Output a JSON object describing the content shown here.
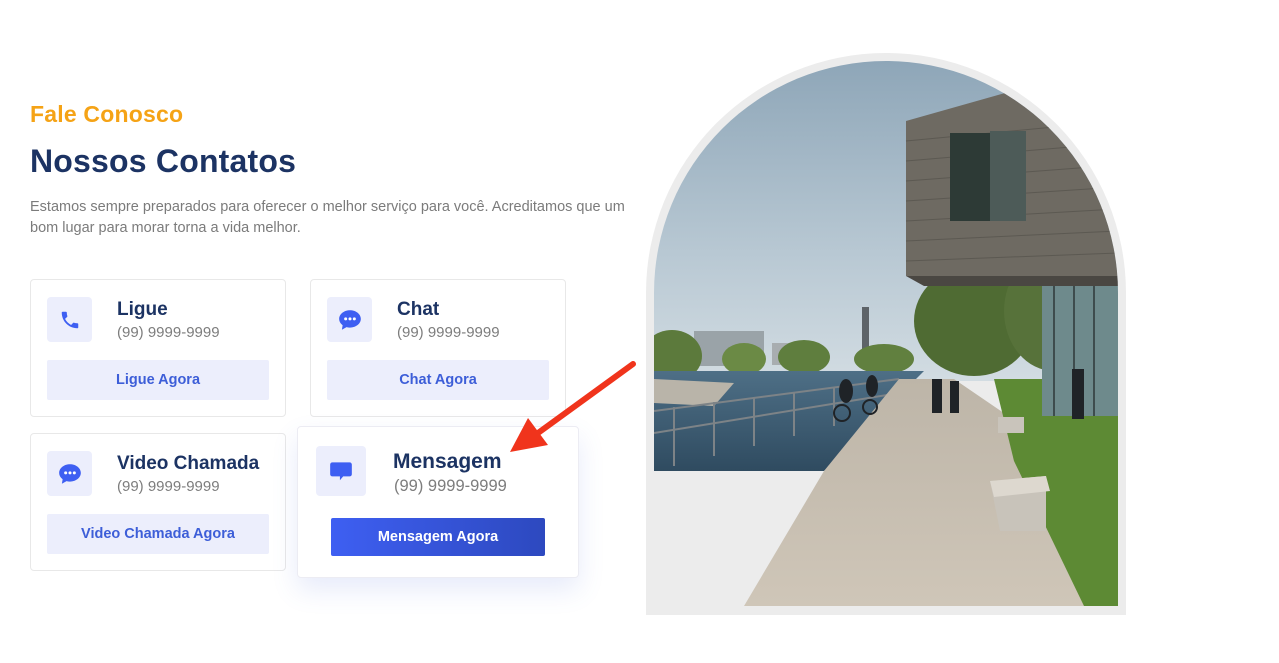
{
  "header": {
    "eyebrow": "Fale Conosco",
    "title": "Nossos Contatos",
    "description": "Estamos sempre preparados para oferecer o melhor serviço para você. Acreditamos que um bom lugar para morar torna a vida melhor."
  },
  "cards": [
    {
      "icon": "phone-icon",
      "title": "Ligue",
      "phone": "(99) 9999-9999",
      "button": "Ligue Agora"
    },
    {
      "icon": "chat-bubble-icon",
      "title": "Chat",
      "phone": "(99) 9999-9999",
      "button": "Chat Agora"
    },
    {
      "icon": "chat-bubble-icon",
      "title": "Video Chamada",
      "phone": "(99) 9999-9999",
      "button": "Video Chamada Agora"
    },
    {
      "icon": "message-icon",
      "title": "Mensagem",
      "phone": "(99) 9999-9999",
      "button": "Mensagem Agora",
      "highlighted": true
    }
  ],
  "colors": {
    "accent": "#f5a316",
    "heading": "#1c3363",
    "primary": "#3e5ff2",
    "icon_bg": "#eceefc",
    "annotation_arrow": "#f0341c"
  }
}
